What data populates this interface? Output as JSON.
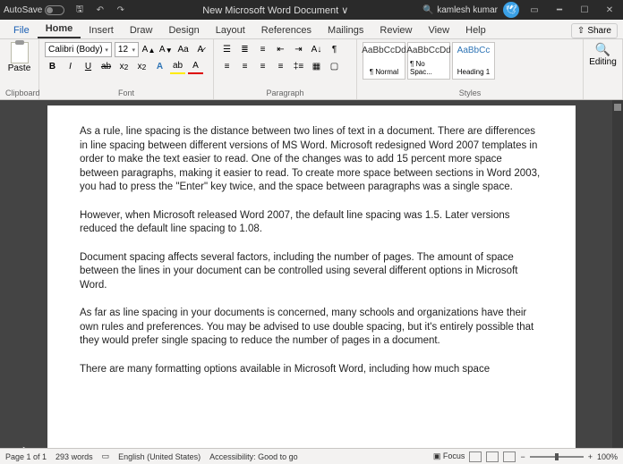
{
  "titlebar": {
    "autosave": "AutoSave",
    "autosave_state": "Off",
    "doc_title": "New Microsoft Word Document ∨",
    "user": "kamlesh kumar"
  },
  "tabs": {
    "file": "File",
    "home": "Home",
    "insert": "Insert",
    "draw": "Draw",
    "design": "Design",
    "layout": "Layout",
    "references": "References",
    "mailings": "Mailings",
    "review": "Review",
    "view": "View",
    "help": "Help",
    "share": "Share"
  },
  "ribbon": {
    "clipboard": {
      "paste": "Paste",
      "label": "Clipboard"
    },
    "font": {
      "name": "Calibri (Body)",
      "size": "12",
      "label": "Font"
    },
    "paragraph": {
      "label": "Paragraph"
    },
    "styles": {
      "preview": "AaBbCcDd",
      "previewH": "AaBbCc",
      "s1": "¶ Normal",
      "s2": "¶ No Spac...",
      "s3": "Heading 1",
      "label": "Styles"
    },
    "editing": {
      "btn": "Editing",
      "label": ""
    }
  },
  "doc": {
    "p1": "As a rule, line spacing is the distance between two lines of text in a document. There are differences in line spacing between different versions of MS Word. Microsoft redesigned Word 2007 templates in order to make the text easier to read. One of the changes was to add 15 percent more space between paragraphs, making it easier to read. To create more space between sections in Word 2003, you had to press the \"Enter\" key twice, and the space between paragraphs was a single space.",
    "p2": "However, when Microsoft released Word 2007, the default line spacing was 1.5. Later versions reduced the default line spacing to 1.08.",
    "p3": "Document spacing affects several factors, including the number of pages. The amount of space between the lines in your document can be controlled using several different options in Microsoft Word.",
    "p4": "As far as line spacing in your documents is concerned, many schools and organizations have their own rules and preferences. You may be advised to use double spacing, but it's entirely possible that they would prefer single spacing to reduce the number of pages in a document.",
    "p5": "There are many formatting options available in Microsoft Word, including how much space"
  },
  "status": {
    "page": "Page 1 of 1",
    "words": "293 words",
    "lang": "English (United States)",
    "access": "Accessibility: Good to go",
    "focus": "Focus",
    "zoom": "100%"
  }
}
